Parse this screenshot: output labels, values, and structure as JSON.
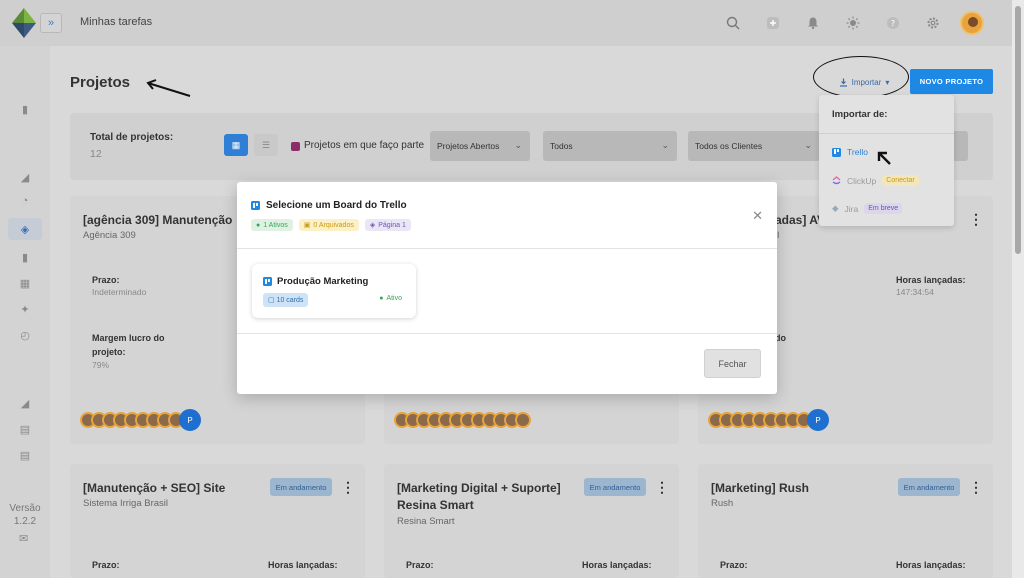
{
  "header": {
    "breadcrumb": "Minhas tarefas",
    "expand_symbol": "»"
  },
  "sidebar": {
    "version_label": "Versão",
    "version_number": "1.2.2"
  },
  "page": {
    "title": "Projetos",
    "import_label": "Importar",
    "new_project_label": "NOVO PROJETO"
  },
  "filters": {
    "total_label": "Total de projetos:",
    "total_value": "12",
    "checkbox_label": "Projetos em que faço parte",
    "select_status": "Projetos Abertos",
    "select_all": "Todos",
    "select_clients": "Todos os Clientes"
  },
  "cards": [
    {
      "title": "[agência 309] Manutenção",
      "subtitle": "Agência 309",
      "deadline_label": "Prazo:",
      "deadline_value": "Indeterminado",
      "margin_label": "Margem lucro do projeto:",
      "margin_value": "79%"
    },
    {
      "title_fragment": "adas] AV",
      "subtitle_fragment": "il",
      "hours_label": "Horas lançadas:",
      "hours_value": "147:34:54",
      "margin_fragment": "do"
    },
    {
      "title": "[Manutenção + SEO] Site",
      "subtitle": "Sistema Irriga Brasil",
      "status": "Em andamento",
      "deadline_label": "Prazo:",
      "hours_label": "Horas lançadas:"
    },
    {
      "title": "[Marketing Digital + Suporte] Resina Smart",
      "subtitle": "Resina Smart",
      "status": "Em andamento",
      "deadline_label": "Prazo:",
      "hours_label": "Horas lançadas:"
    },
    {
      "title": "[Marketing] Rush",
      "subtitle": "Rush",
      "status": "Em andamento",
      "deadline_label": "Prazo:",
      "hours_label": "Horas lançadas:"
    }
  ],
  "avatar_overflow": "P",
  "dropdown": {
    "header": "Importar de:",
    "items": [
      {
        "label": "Trello",
        "color": "#2f7fd6"
      },
      {
        "label": "ClickUp",
        "pill": "Conectar",
        "color": "#9a9a9a"
      },
      {
        "label": "Jira",
        "pill": "Em breve",
        "color": "#9a9a9a"
      }
    ]
  },
  "modal": {
    "title": "Selecione um Board do Trello",
    "badge_active": "1 Ativos",
    "badge_archived": "0 Arquivados",
    "badge_page": "Página 1",
    "board": {
      "name": "Produção Marketing",
      "cards": "10 cards",
      "status": "Ativo"
    },
    "close_label": "Fechar"
  },
  "colors": {
    "primary": "#1e88e5",
    "accent_purple": "#8c2d6a",
    "active_green": "#3aa35a"
  }
}
